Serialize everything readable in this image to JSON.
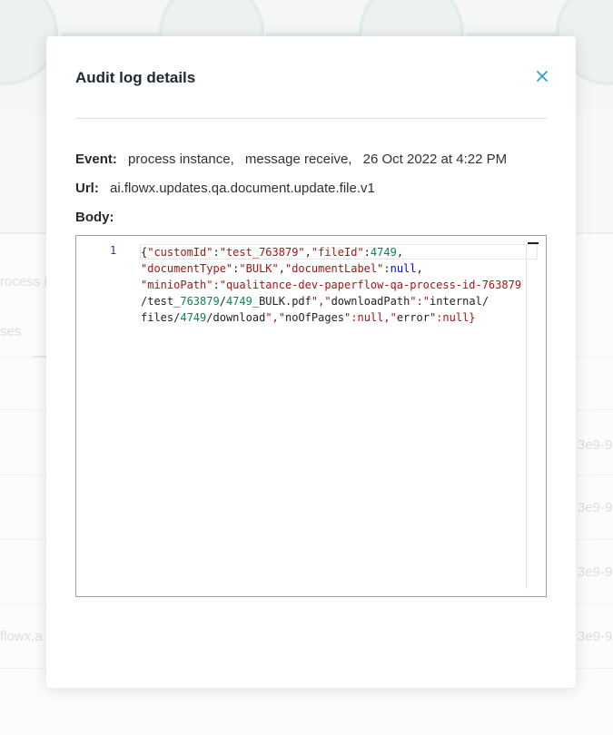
{
  "background": {
    "left_texts": [
      "rocess in",
      "ses",
      "flowx.a"
    ],
    "right_texts": [
      "3e9-9",
      "3e9-9",
      "3e9-9",
      "3e9-9"
    ]
  },
  "modal": {
    "title": "Audit log details",
    "close_icon": "close-icon",
    "event": {
      "label": "Event:",
      "parts": [
        "process instance,",
        "message receive,",
        "26 Oct 2022 at 4:22 PM"
      ]
    },
    "url": {
      "label": "Url:",
      "value": "ai.flowx.updates.qa.document.update.file.v1"
    },
    "body": {
      "label": "Body:",
      "line_number": "1",
      "code_lines": [
        "{\"customId\":\"test_763879\",\"fileId\":4749,",
        "\"documentType\":\"BULK\",\"documentLabel\":null,",
        "\"minioPath\":\"qualitance-dev-paperflow-qa-process-id-763879",
        "/test_763879/4749_BULK.pdf\",\"downloadPath\":\"internal/",
        "files/4749/download\",\"noOfPages\":null,\"error\":null}"
      ]
    }
  },
  "colors": {
    "key": "#a31515",
    "string": "#a31515",
    "number": "#098658",
    "null": "#0000ff",
    "close": "#2aa0d8"
  }
}
